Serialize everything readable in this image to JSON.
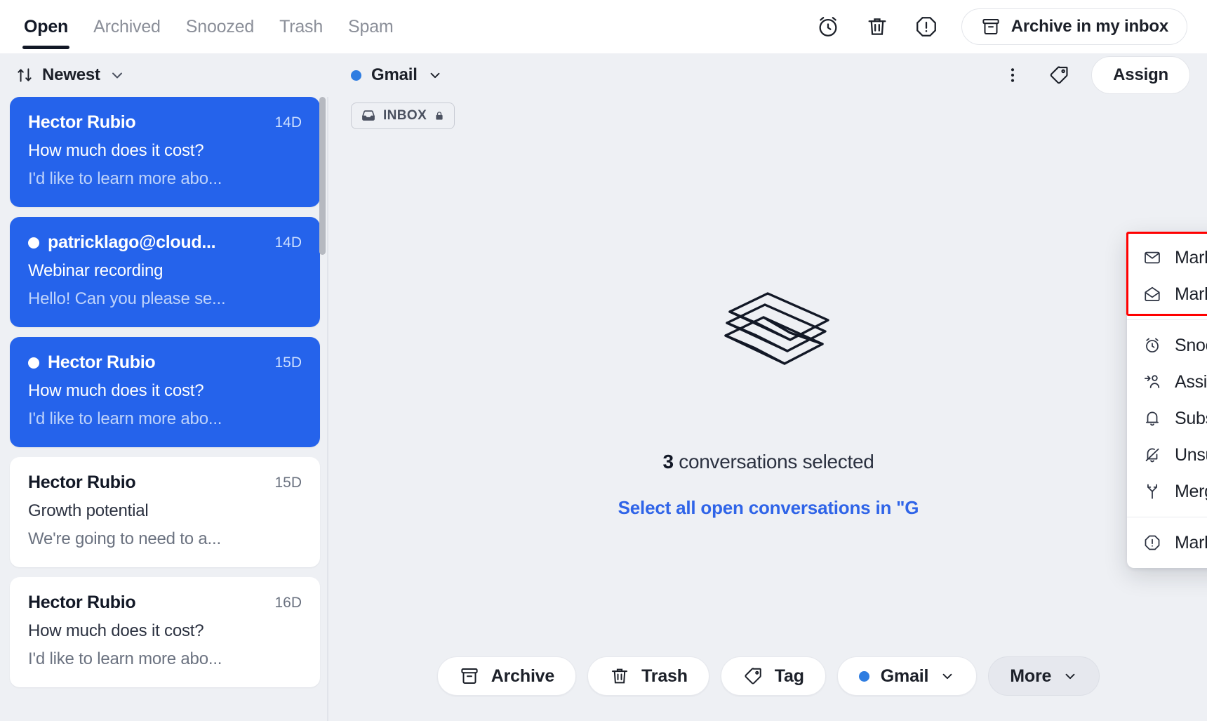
{
  "topbar": {
    "tabs": [
      {
        "label": "Open",
        "active": true
      },
      {
        "label": "Archived",
        "active": false
      },
      {
        "label": "Snoozed",
        "active": false
      },
      {
        "label": "Trash",
        "active": false
      },
      {
        "label": "Spam",
        "active": false
      }
    ],
    "icons": [
      {
        "name": "alarm-clock-icon",
        "title": "Snooze"
      },
      {
        "name": "trash-icon",
        "title": "Trash"
      },
      {
        "name": "octagon-alert-icon",
        "title": "Mark as spam"
      }
    ],
    "archive_button": {
      "label": "Archive in my inbox",
      "icon": "archive-box-icon"
    }
  },
  "sort": {
    "label": "Newest",
    "icon": "sort-arrows-icon",
    "chevron": "chevron-down-icon"
  },
  "conversations": [
    {
      "name": "Hector Rubio",
      "age": "14D",
      "subject": "How much does it cost?",
      "preview": "I'd like to learn more abo...",
      "selected": true,
      "unread": false
    },
    {
      "name": "patricklago@cloud...",
      "age": "14D",
      "subject": "Webinar recording",
      "preview": "Hello! Can you please se...",
      "selected": true,
      "unread": true
    },
    {
      "name": "Hector Rubio",
      "age": "15D",
      "subject": "How much does it cost?",
      "preview": "I'd like to learn more abo...",
      "selected": true,
      "unread": true
    },
    {
      "name": "Hector Rubio",
      "age": "15D",
      "subject": "Growth potential",
      "preview": "We're going to need to a...",
      "selected": false,
      "unread": false
    },
    {
      "name": "Hector Rubio",
      "age": "16D",
      "subject": "How much does it cost?",
      "preview": "I'd like to learn more abo...",
      "selected": false,
      "unread": false
    }
  ],
  "main": {
    "channel": {
      "label": "Gmail",
      "dot_color": "#2f7de1",
      "chevron": "chevron-down-icon"
    },
    "more_icon": "vertical-dots-icon",
    "tag_icon": "tag-icon",
    "assign_label": "Assign",
    "inbox_badge": {
      "label": "INBOX",
      "icon": "inbox-tray-icon",
      "lock_icon": "lock-icon"
    },
    "empty": {
      "illustration": "envelopes-illustration",
      "count_number": "3",
      "count_text": " conversations selected",
      "select_all_link": "Select all open conversations in \"G"
    }
  },
  "actionbar": [
    {
      "label": "Archive",
      "icon": "archive-box-icon",
      "style": "white"
    },
    {
      "label": "Trash",
      "icon": "trash-icon",
      "style": "white"
    },
    {
      "label": "Tag",
      "icon": "tag-icon",
      "style": "white"
    },
    {
      "label": "Gmail",
      "icon": "blue-dot-icon",
      "chevron": "chevron-down-icon",
      "style": "white"
    },
    {
      "label": "More",
      "icon": "",
      "chevron": "chevron-down-icon",
      "style": "ghost-active"
    }
  ],
  "menu": {
    "highlight_color": "#ff0000",
    "groups": [
      {
        "highlighted": true,
        "items": [
          {
            "label": "Mark as unread",
            "icon": "envelope-closed-icon"
          },
          {
            "label": "Mark as read",
            "icon": "envelope-open-icon"
          }
        ]
      },
      {
        "highlighted": false,
        "items": [
          {
            "label": "Snooze",
            "icon": "alarm-clock-icon"
          },
          {
            "label": "Assign",
            "icon": "person-arrow-icon"
          },
          {
            "label": "Subscribe",
            "icon": "bell-icon"
          },
          {
            "label": "Unsubscribe",
            "icon": "bell-slash-icon"
          },
          {
            "label": "Merge conversations",
            "icon": "merge-icon"
          }
        ]
      },
      {
        "highlighted": false,
        "items": [
          {
            "label": "Mark as spam",
            "icon": "octagon-alert-icon"
          }
        ]
      }
    ]
  }
}
